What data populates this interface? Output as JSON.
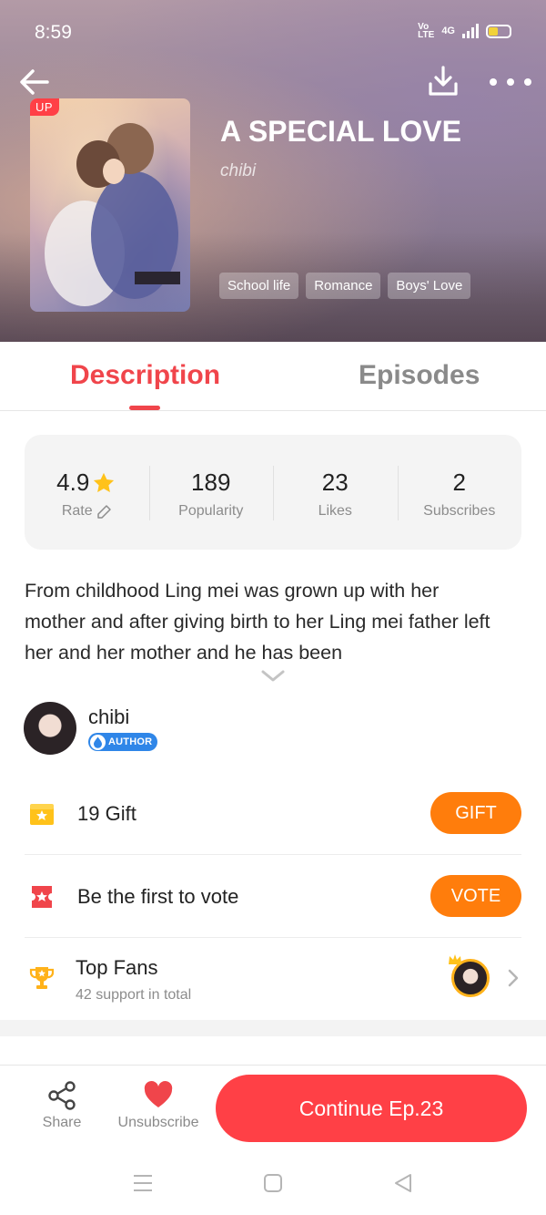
{
  "status_bar": {
    "time": "8:59",
    "network_label_top": "Vo",
    "network_label_bottom": "LTE",
    "network_type": "4G",
    "battery_level": 0.45,
    "battery_color": "#f1d23a"
  },
  "header": {
    "back_icon": "arrow-left-icon",
    "download_icon": "download-icon",
    "more_icon": "more-horizontal-icon"
  },
  "book": {
    "badge": "UP",
    "title": "A SPECIAL LOVE",
    "author": "chibi",
    "tags": [
      "School life",
      "Romance",
      "Boys' Love"
    ]
  },
  "tabs": {
    "description": "Description",
    "episodes": "Episodes",
    "active": "description"
  },
  "stats": [
    {
      "value": "4.9",
      "label": "Rate",
      "icon": "star-icon",
      "label_icon": "edit-icon"
    },
    {
      "value": "189",
      "label": "Popularity"
    },
    {
      "value": "23",
      "label": "Likes"
    },
    {
      "value": "2",
      "label": "Subscribes"
    }
  ],
  "description": {
    "text": "From childhood Ling mei  was grown up with her mother and after giving birth to her Ling mei father left her and her mother and he has been",
    "expand_icon": "chevron-down-icon"
  },
  "author": {
    "name": "chibi",
    "badge": "AUTHOR"
  },
  "gift": {
    "label": "19  Gift",
    "button": "GIFT",
    "icon": "gift-icon"
  },
  "vote": {
    "label": "Be the first to vote",
    "button": "VOTE",
    "icon": "ticket-icon"
  },
  "top_fans": {
    "label": "Top Fans",
    "sub": "42 support in total",
    "icon": "trophy-icon"
  },
  "bottom_bar": {
    "share": "Share",
    "unsubscribe": "Unsubscribe",
    "continue": "Continue Ep.23"
  },
  "colors": {
    "accent": "#f0454b",
    "cta": "#ff4046",
    "orange": "#ff7d0c",
    "author_badge": "#2f86e8"
  }
}
